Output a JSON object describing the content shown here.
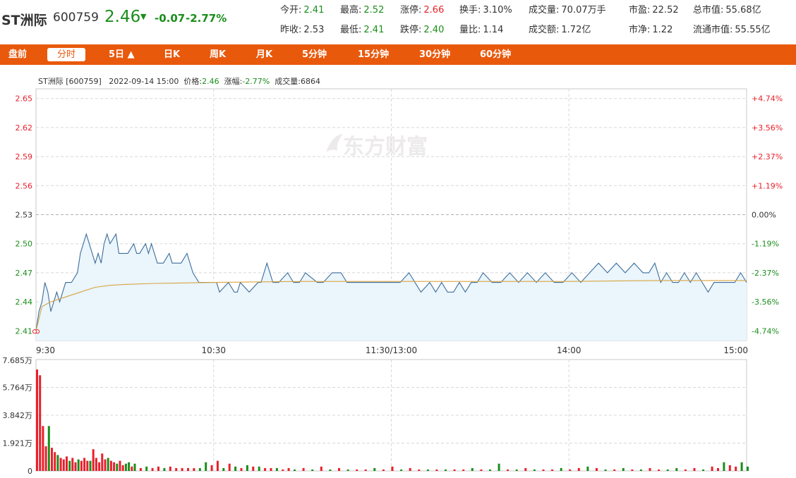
{
  "header": {
    "name": "ST洲际",
    "code": "600759",
    "price": "2.46",
    "change": "-0.07",
    "change_pct": "-2.77%"
  },
  "stats_row1": [
    {
      "label": "今开:",
      "value": "2.41",
      "color": "down"
    },
    {
      "label": "最高:",
      "value": "2.52",
      "color": "down"
    },
    {
      "label": "涨停:",
      "value": "2.66",
      "color": "up"
    },
    {
      "label": "换手:",
      "value": "3.10%",
      "color": "neutral"
    },
    {
      "label": "成交量:",
      "value": "70.07万手",
      "color": "neutral"
    },
    {
      "label": "市盈:",
      "value": "22.52",
      "color": "neutral"
    },
    {
      "label": "总市值:",
      "value": "55.68亿",
      "color": "neutral"
    }
  ],
  "stats_row2": [
    {
      "label": "昨收:",
      "value": "2.53",
      "color": "neutral"
    },
    {
      "label": "最低:",
      "value": "2.41",
      "color": "down"
    },
    {
      "label": "跌停:",
      "value": "2.40",
      "color": "down"
    },
    {
      "label": "量比:",
      "value": "1.14",
      "color": "neutral"
    },
    {
      "label": "成交额:",
      "value": "1.72亿",
      "color": "neutral"
    },
    {
      "label": "市净:",
      "value": "1.22",
      "color": "neutral"
    },
    {
      "label": "流通市值:",
      "value": "55.55亿",
      "color": "neutral"
    }
  ],
  "tabs": [
    "盘前",
    "分时",
    "5日 ▲",
    "日K",
    "周K",
    "月K",
    "5分钟",
    "15分钟",
    "30分钟",
    "60分钟"
  ],
  "active_tab": 1,
  "chart_info": {
    "name_code": "ST洲际 [600759]",
    "datetime": "2022-09-14 15:00",
    "price_label": "价格:",
    "price": "2.46",
    "change_label": "涨幅:",
    "change": "-2.77%",
    "volume_label": "成交量:",
    "volume": "6864"
  },
  "watermark": "东方财富",
  "colors": {
    "up": "#e8202c",
    "down": "#1a8e1a",
    "price_line": "#3d6d9a",
    "avg_line": "#d9a441",
    "area_fill": "#eaf5fc",
    "accent": "#e9590c"
  },
  "chart_data": [
    {
      "type": "line",
      "prev_close": 2.53,
      "ylim": [
        2.4,
        2.66
      ],
      "y_ticks": [
        2.65,
        2.62,
        2.59,
        2.56,
        2.53,
        2.5,
        2.47,
        2.44,
        2.41
      ],
      "y_ticks_pct": [
        "+4.74%",
        "+3.56%",
        "+2.37%",
        "+1.19%",
        "0.00%",
        "-1.19%",
        "-2.37%",
        "-3.56%",
        "-4.74%"
      ],
      "x_ticks": [
        "9:30",
        "10:30",
        "11:30/13:00",
        "14:00",
        "15:00"
      ],
      "x_tick_minutes": [
        0,
        60,
        120,
        180,
        240
      ],
      "x_range": [
        0,
        240
      ],
      "series": [
        {
          "type": "line",
          "x": [
            0,
            1,
            2,
            3,
            4,
            5,
            6,
            7,
            8,
            9,
            10,
            12,
            14,
            15,
            17,
            18,
            19,
            20,
            21,
            22,
            23,
            24,
            25,
            27,
            28,
            29,
            30,
            31,
            33,
            34,
            35,
            37,
            38,
            39,
            41,
            43,
            45,
            46,
            47,
            48,
            49,
            51,
            53,
            55,
            57,
            58,
            59,
            60,
            61,
            62,
            65,
            67,
            68,
            69,
            72,
            75,
            76,
            78,
            80,
            82,
            85,
            87,
            88,
            89,
            91,
            95,
            97,
            100,
            103,
            105,
            107,
            110,
            113,
            116,
            120,
            123,
            126,
            130,
            133,
            135,
            137,
            139,
            141,
            143,
            145,
            147,
            149,
            151,
            154,
            157,
            160,
            163,
            166,
            169,
            172,
            175,
            178,
            181,
            184,
            187,
            190,
            193,
            196,
            199,
            202,
            205,
            207,
            209,
            211,
            213,
            215,
            217,
            219,
            221,
            223,
            225,
            227,
            229,
            231,
            233,
            236,
            238,
            240
          ],
          "values": [
            2.41,
            2.43,
            2.44,
            2.46,
            2.45,
            2.43,
            2.44,
            2.45,
            2.44,
            2.45,
            2.46,
            2.46,
            2.47,
            2.49,
            2.51,
            2.5,
            2.49,
            2.48,
            2.49,
            2.48,
            2.5,
            2.51,
            2.5,
            2.51,
            2.49,
            2.49,
            2.49,
            2.49,
            2.5,
            2.49,
            2.49,
            2.5,
            2.49,
            2.5,
            2.48,
            2.48,
            2.49,
            2.48,
            2.48,
            2.48,
            2.48,
            2.49,
            2.47,
            2.46,
            2.46,
            2.46,
            2.46,
            2.46,
            2.46,
            2.45,
            2.46,
            2.45,
            2.45,
            2.46,
            2.45,
            2.46,
            2.46,
            2.48,
            2.46,
            2.46,
            2.47,
            2.46,
            2.46,
            2.46,
            2.47,
            2.46,
            2.46,
            2.47,
            2.47,
            2.46,
            2.46,
            2.46,
            2.46,
            2.46,
            2.46,
            2.46,
            2.47,
            2.45,
            2.46,
            2.45,
            2.46,
            2.45,
            2.45,
            2.46,
            2.45,
            2.46,
            2.46,
            2.47,
            2.46,
            2.46,
            2.47,
            2.46,
            2.47,
            2.46,
            2.47,
            2.46,
            2.46,
            2.47,
            2.46,
            2.47,
            2.48,
            2.47,
            2.48,
            2.47,
            2.48,
            2.47,
            2.47,
            2.48,
            2.46,
            2.47,
            2.46,
            2.46,
            2.47,
            2.46,
            2.47,
            2.46,
            2.45,
            2.46,
            2.46,
            2.46,
            2.46,
            2.47,
            2.46
          ]
        },
        {
          "type": "line",
          "x": [
            0,
            2,
            5,
            10,
            15,
            20,
            25,
            30,
            40,
            60,
            90,
            120,
            150,
            180,
            210,
            240
          ],
          "values": [
            2.41,
            2.435,
            2.44,
            2.445,
            2.45,
            2.455,
            2.457,
            2.458,
            2.459,
            2.46,
            2.461,
            2.461,
            2.461,
            2.461,
            2.462,
            2.462
          ]
        }
      ]
    },
    {
      "type": "bar",
      "ylim": [
        0,
        7.685
      ],
      "y_ticks": [
        "0",
        "1.921万",
        "3.842万",
        "5.764万",
        "7.685万"
      ],
      "y_tick_values": [
        0,
        1.921,
        3.842,
        5.764,
        7.685
      ],
      "x_range": [
        0,
        240
      ],
      "x": [
        0,
        1,
        2,
        3,
        4,
        5,
        6,
        7,
        8,
        9,
        10,
        11,
        12,
        13,
        14,
        15,
        16,
        17,
        18,
        19,
        20,
        21,
        22,
        23,
        24,
        25,
        26,
        27,
        28,
        29,
        30,
        31,
        32,
        33,
        35,
        37,
        39,
        41,
        43,
        45,
        47,
        49,
        51,
        53,
        55,
        57,
        59,
        61,
        63,
        65,
        67,
        69,
        71,
        73,
        75,
        77,
        79,
        81,
        83,
        85,
        87,
        90,
        93,
        96,
        99,
        102,
        105,
        108,
        111,
        114,
        117,
        120,
        123,
        126,
        129,
        132,
        135,
        138,
        141,
        144,
        147,
        150,
        153,
        156,
        159,
        162,
        165,
        168,
        171,
        174,
        177,
        180,
        183,
        186,
        189,
        192,
        195,
        198,
        201,
        204,
        207,
        210,
        213,
        216,
        219,
        222,
        225,
        228,
        230,
        232,
        234,
        236,
        238,
        240
      ],
      "values": [
        7.0,
        6.6,
        3.1,
        1.7,
        3.1,
        1.6,
        1.3,
        1.1,
        0.9,
        0.8,
        1.0,
        0.7,
        0.9,
        0.6,
        0.8,
        0.7,
        0.9,
        0.7,
        0.7,
        1.5,
        0.9,
        0.6,
        1.2,
        0.8,
        0.9,
        0.7,
        0.6,
        0.5,
        0.7,
        0.4,
        0.5,
        0.6,
        0.3,
        0.5,
        0.2,
        0.3,
        0.2,
        0.3,
        0.2,
        0.3,
        0.2,
        0.2,
        0.2,
        0.2,
        0.2,
        0.6,
        0.4,
        0.7,
        0.2,
        0.5,
        0.3,
        0.2,
        0.4,
        0.3,
        0.3,
        0.2,
        0.2,
        0.2,
        0.1,
        0.2,
        0.1,
        0.2,
        0.1,
        0.3,
        0.1,
        0.2,
        0.1,
        0.1,
        0.1,
        0.2,
        0.1,
        0.3,
        0.1,
        0.2,
        0.1,
        0.1,
        0.1,
        0.1,
        0.1,
        0.1,
        0.2,
        0.1,
        0.1,
        0.5,
        0.1,
        0.1,
        0.2,
        0.1,
        0.1,
        0.1,
        0.2,
        0.1,
        0.2,
        0.3,
        0.2,
        0.1,
        0.1,
        0.2,
        0.1,
        0.1,
        0.2,
        0.1,
        0.1,
        0.2,
        0.1,
        0.2,
        0.1,
        0.3,
        0.2,
        0.6,
        0.4,
        0.3,
        0.6,
        0.3,
        0.4
      ],
      "directions": [
        "up",
        "up",
        "up",
        "up",
        "down",
        "up",
        "up",
        "down",
        "up",
        "up",
        "up",
        "down",
        "up",
        "up",
        "down",
        "up",
        "up",
        "up",
        "down",
        "up",
        "up",
        "up",
        "up",
        "up",
        "down",
        "up",
        "up",
        "down",
        "up",
        "up",
        "down",
        "down",
        "up",
        "down",
        "up",
        "down",
        "up",
        "up",
        "down",
        "up",
        "up",
        "up",
        "up",
        "up",
        "down",
        "down",
        "up",
        "up",
        "down",
        "up",
        "down",
        "up",
        "down",
        "up",
        "down",
        "up",
        "up",
        "down",
        "up",
        "up",
        "down",
        "up",
        "down",
        "up",
        "down",
        "up",
        "down",
        "up",
        "up",
        "down",
        "up",
        "up",
        "down",
        "up",
        "up",
        "down",
        "up",
        "down",
        "up",
        "up",
        "down",
        "up",
        "down",
        "down",
        "up",
        "down",
        "up",
        "down",
        "up",
        "up",
        "down",
        "up",
        "up",
        "down",
        "up",
        "down",
        "up",
        "down",
        "up",
        "down",
        "up",
        "up",
        "down",
        "down",
        "up",
        "up",
        "down",
        "up",
        "up",
        "down",
        "up",
        "up",
        "down",
        "down"
      ]
    }
  ]
}
